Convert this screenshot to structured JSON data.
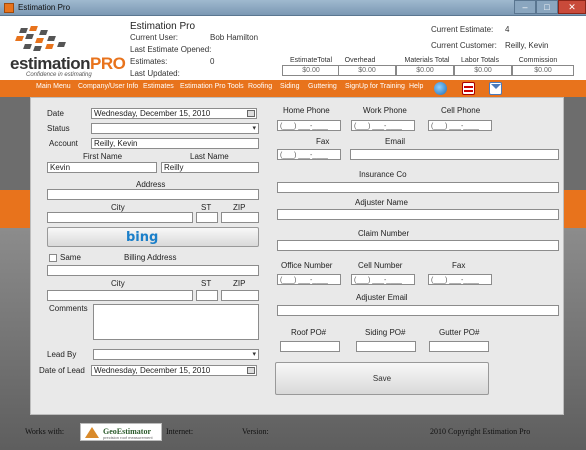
{
  "window": {
    "title": "Estimation Pro",
    "controls": {
      "minimize": "–",
      "maximize": "□",
      "close": "✕"
    }
  },
  "header": {
    "logo_prefix": "estimation",
    "logo_suffix": "PRO",
    "logo_tagline": "Confidence in estimating",
    "app_name": "Estimation Pro",
    "current_user_label": "Current User:",
    "current_user_value": "Bob Hamilton",
    "last_estimate_label": "Last Estimate Opened:",
    "estimates_label": "Estimates:",
    "estimates_value": "0",
    "last_updated_label": "Last Updated:",
    "current_estimate_label": "Current Estimate:",
    "current_estimate_value": "4",
    "current_customer_label": "Current Customer:",
    "current_customer_value": "Reilly, Kevin",
    "totals": [
      {
        "label": "EstimateTotal",
        "value": "$0.00"
      },
      {
        "label": "Overhead",
        "value": "$0.00"
      },
      {
        "label": "Materials Total",
        "value": "$0.00"
      },
      {
        "label": "Labor Totals",
        "value": "$0.00"
      },
      {
        "label": "Commission",
        "value": "$0.00"
      }
    ]
  },
  "menu": {
    "items": [
      "Main Menu",
      "Company/User Info",
      "Estimates",
      "Estimation Pro Tools",
      "Roofing",
      "Siding",
      "Guttering",
      "SignUp for Training",
      "Help"
    ],
    "icons": [
      "globe-icon",
      "document-icon",
      "mail-icon"
    ]
  },
  "form": {
    "date_label": "Date",
    "date_value": "Wednesday, December 15, 2010",
    "status_label": "Status",
    "status_value": "",
    "account_label": "Account",
    "account_value": "Reilly, Kevin",
    "first_name_label": "First Name",
    "first_name_value": "Kevin",
    "last_name_label": "Last Name",
    "last_name_value": "Reilly",
    "address_label": "Address",
    "city_label": "City",
    "st_label": "ST",
    "zip_label": "ZIP",
    "map_button": "bing",
    "same_label": "Same",
    "billing_address_label": "Billing Address",
    "billing_city_label": "City",
    "billing_st_label": "ST",
    "billing_zip_label": "ZIP",
    "comments_label": "Comments",
    "lead_by_label": "Lead By",
    "date_of_lead_label": "Date of Lead",
    "date_of_lead_value": "Wednesday, December 15, 2010",
    "home_phone_label": "Home Phone",
    "work_phone_label": "Work Phone",
    "cell_phone_label": "Cell Phone",
    "fax_label": "Fax",
    "email_label": "Email",
    "phone_mask": "(___) ___-____",
    "insurance_co_label": "Insurance Co",
    "adjuster_name_label": "Adjuster Name",
    "claim_number_label": "Claim Number",
    "office_number_label": "Office Number",
    "adj_cell_number_label": "Cell Number",
    "adj_fax_label": "Fax",
    "adjuster_email_label": "Adjuster Email",
    "roof_po_label": "Roof PO#",
    "siding_po_label": "Siding PO#",
    "gutter_po_label": "Gutter PO#",
    "save_button": "Save"
  },
  "footer": {
    "works_with": "Works with:",
    "geo_name": "GeoEstimator",
    "geo_tagline": "precision roof measurement",
    "internet_label": "Internet:",
    "version_label": "Version:",
    "copyright": "2010 Copyright Estimation Pro"
  },
  "colors": {
    "accent": "#e8731c",
    "panel": "#e9e9e9",
    "background": "#6d6d6d"
  }
}
